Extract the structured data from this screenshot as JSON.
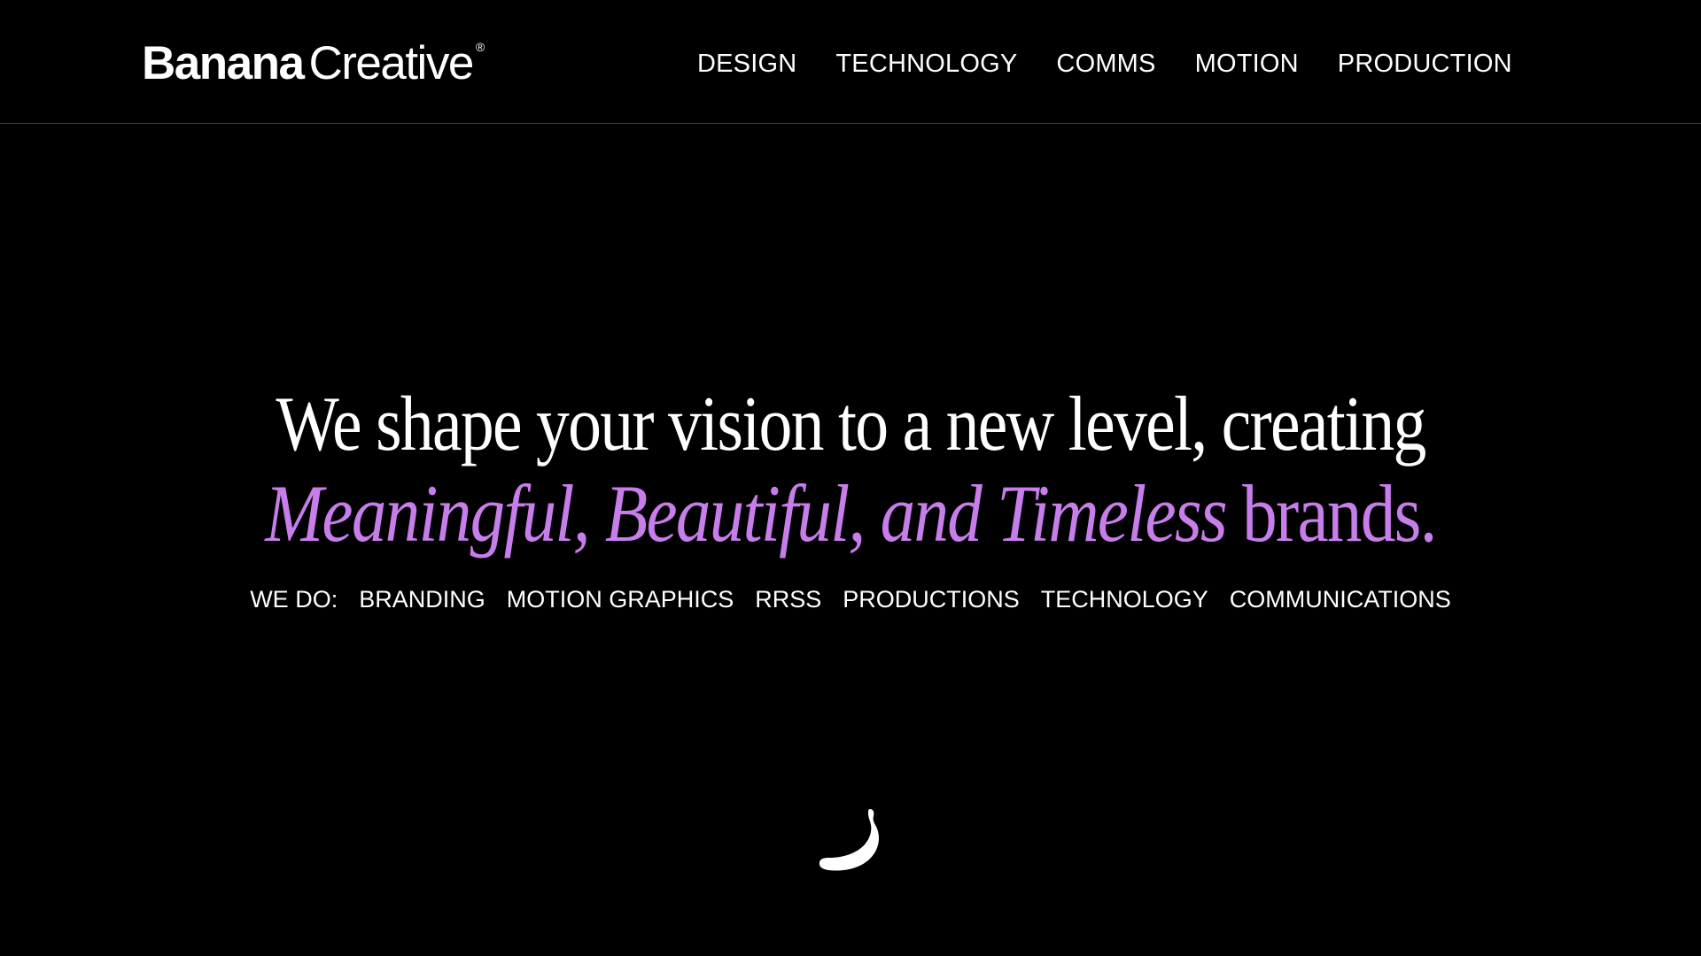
{
  "brand": {
    "name_bold": "Banana",
    "name_light": "Creative",
    "registered_mark": "®"
  },
  "nav": {
    "items": [
      "DESIGN",
      "TECHNOLOGY",
      "COMMS",
      "MOTION",
      "PRODUCTION"
    ]
  },
  "hero": {
    "line1": "We shape your vision to a new level, creating",
    "line2_italic": "Meaningful, Beautiful, and Timeless",
    "line2_regular": " brands.",
    "accent_color": "#c77dea"
  },
  "services": {
    "label": "WE DO:",
    "items": [
      "BRANDING",
      "MOTION GRAPHICS",
      "RRSS",
      "PRODUCTIONS",
      "TECHNOLOGY",
      "COMMUNICATIONS"
    ]
  },
  "icons": {
    "scroll_indicator": "banana-icon"
  },
  "colors": {
    "background": "#000000",
    "text": "#ffffff",
    "divider": "#3a3a3a"
  }
}
